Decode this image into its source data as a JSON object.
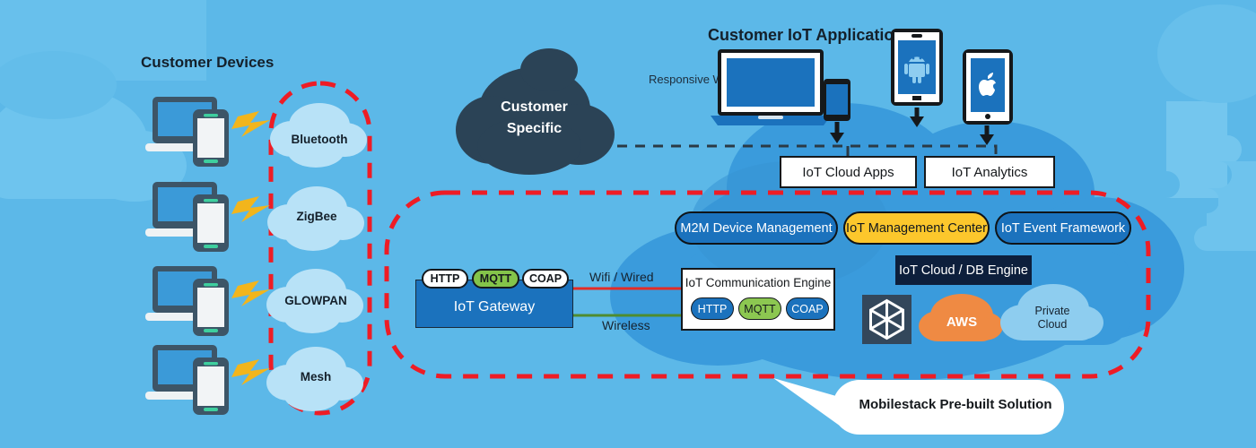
{
  "headings": {
    "customer_devices": "Customer Devices",
    "customer_app": "Customer IoT Application",
    "responsive_web": "Responsive Web"
  },
  "device_rows": [
    {
      "protocol": "Bluetooth"
    },
    {
      "protocol": "ZigBee"
    },
    {
      "protocol": "GLOWPAN"
    },
    {
      "protocol": "Mesh"
    }
  ],
  "customer_specific_cloud": {
    "line1": "Customer",
    "line2": "Specific"
  },
  "top_boxes": [
    {
      "label": "IoT Cloud Apps"
    },
    {
      "label": "IoT Analytics"
    }
  ],
  "service_pills": [
    {
      "label": "M2M Device Management",
      "color": "blue"
    },
    {
      "label": "IoT Management Center",
      "color": "yellow"
    },
    {
      "label": "IoT Event Framework",
      "color": "blue"
    }
  ],
  "gateway": {
    "label": "IoT Gateway",
    "protocols": [
      {
        "label": "HTTP",
        "style": "white"
      },
      {
        "label": "MQTT",
        "style": "green"
      },
      {
        "label": "COAP",
        "style": "white"
      }
    ]
  },
  "links": {
    "wifi_wired": "Wifi / Wired",
    "wireless": "Wireless"
  },
  "comm_engine": {
    "title": "IoT Communication Engine",
    "protocols": [
      {
        "label": "HTTP",
        "style": "blue"
      },
      {
        "label": "MQTT",
        "style": "green"
      },
      {
        "label": "COAP",
        "style": "blue"
      }
    ]
  },
  "db_engine": {
    "label": "IoT Cloud / DB Engine"
  },
  "cloud_vendors": [
    {
      "name": "hexagon-logo",
      "label": ""
    },
    {
      "name": "aws",
      "label": "AWS"
    },
    {
      "name": "private-cloud",
      "label": "Private Cloud",
      "line1": "Private",
      "line2": "Cloud"
    }
  ],
  "callout": {
    "label": "Mobilestack Pre-built Solution"
  },
  "colors": {
    "background": "#5cb8e8",
    "background_light": "#6ec2ec",
    "cloud_main": "#3a9bdc",
    "dark_cloud": "#2b4356",
    "boundary_dashed": "#ee1c25",
    "app_dashed": "#2b3a45",
    "blue_pill": "#1b72bd",
    "yellow_pill": "#fcc72c",
    "green_accent": "#84c44a",
    "db_navy": "#0d1f3c",
    "aws_orange": "#ef8a43",
    "device_slate": "#3d5567",
    "lightning_yellow": "#f2b51c",
    "protocol_cloud": "#b8e2f7",
    "wired_line": "#e32b26",
    "wireless_line": "#4f8c2f"
  }
}
